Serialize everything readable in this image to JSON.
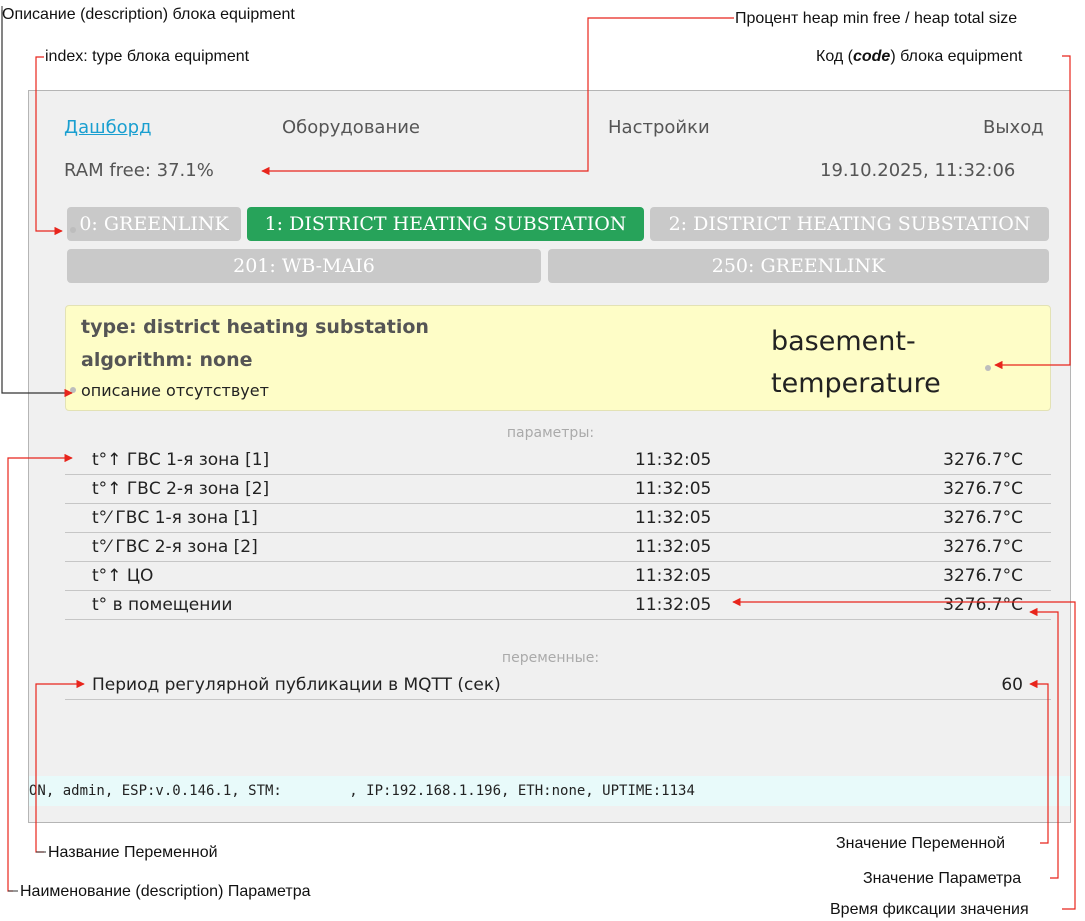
{
  "annotations": {
    "description_block": "Описание (description) блока equipment",
    "heap_percent": "Процент heap min free / heap total size",
    "index_type": "index: type блока equipment",
    "code_before": "Код (",
    "code_word": "code",
    "code_after": ") блока equipment",
    "variable_name": "Название Переменной",
    "param_name": "Наименование (description) Параметра",
    "variable_value": "Значение Переменной",
    "param_value": "Значение Параметра",
    "fix_time": "Время фиксации значения"
  },
  "nav": {
    "dashboard": "Дашборд",
    "equipment": "Оборудование",
    "settings": "Настройки",
    "logout": "Выход"
  },
  "status": {
    "ram": "RAM free: 37.1%",
    "datetime": "19.10.2025, 11:32:06"
  },
  "tabs": [
    {
      "label": "0: GREENLINK",
      "active": false
    },
    {
      "label": "1: DISTRICT HEATING SUBSTATION",
      "active": true
    },
    {
      "label": "2: DISTRICT HEATING SUBSTATION",
      "active": false
    },
    {
      "label": "201: WB-MAI6",
      "active": false
    },
    {
      "label": "250: GREENLINK",
      "active": false
    }
  ],
  "info": {
    "type_line": "type: district heating substation",
    "algorithm_line": "algorithm: none",
    "description": "описание отсутствует",
    "code": "basement-temperature"
  },
  "params_header": "параметры:",
  "params": [
    {
      "name": "t°↑ ГВС 1-я зона [1]",
      "time": "11:32:05",
      "value": "3276.7°C"
    },
    {
      "name": "t°↑ ГВС 2-я зона [2]",
      "time": "11:32:05",
      "value": "3276.7°C"
    },
    {
      "name": "t°⁄ ГВС 1-я зона [1]",
      "time": "11:32:05",
      "value": "3276.7°C"
    },
    {
      "name": "t°⁄ ГВС 2-я зона [2]",
      "time": "11:32:05",
      "value": "3276.7°C"
    },
    {
      "name": "t°↑ ЦО",
      "time": "11:32:05",
      "value": "3276.7°C"
    },
    {
      "name": "t° в помещении",
      "time": "11:32:05",
      "value": "3276.7°C"
    }
  ],
  "vars_header": "переменные:",
  "vars": [
    {
      "name": "Период регулярной публикации в MQTT (сек)",
      "value": "60"
    }
  ],
  "footer": "ON, admin, ESP:v.0.146.1, STM:        , IP:192.168.1.196, ETH:none, UPTIME:1134",
  "colors": {
    "annotation_line": "#e8251c",
    "active_tab": "#27a35a",
    "inactive_tab": "#c9c9c9",
    "info_bg": "#fefdc7",
    "link": "#1a9fd0",
    "footer_bg": "#e8fafa"
  }
}
